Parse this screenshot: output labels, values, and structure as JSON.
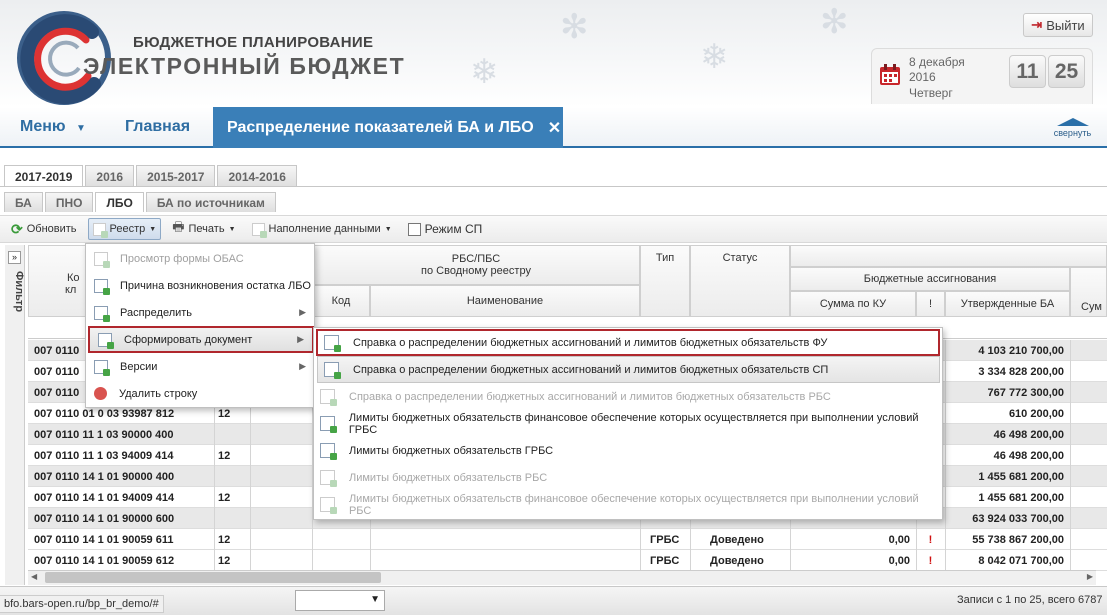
{
  "header": {
    "brand_line1": "БЮДЖЕТНОЕ ПЛАНИРОВАНИЕ",
    "brand_line2": "ЭЛЕКТРОННЫЙ БЮДЖЕТ",
    "logout_label": "Выйти",
    "date_line1": "8 декабря",
    "date_line2": "2016",
    "date_line3": "Четверг",
    "clock_hours": "11",
    "clock_minutes": "25"
  },
  "nav": {
    "menu_label": "Меню",
    "home_label": "Главная",
    "active_tab_label": "Распределение показателей БА и ЛБО",
    "collapse_label": "свернуть"
  },
  "period_tabs": [
    "2017-2019",
    "2016",
    "2015-2017",
    "2014-2016"
  ],
  "type_tabs": [
    "БА",
    "ПНО",
    "ЛБО",
    "БА по источникам"
  ],
  "toolbar": {
    "refresh": "Обновить",
    "registry": "Реестр",
    "print": "Печать",
    "fill_data": "Наполнение данными",
    "sp_mode": "Режим СП"
  },
  "filter_label": "Фильтр",
  "columns": {
    "code_class_part1": "Ко",
    "code_class_part2": "кл",
    "rbs": "РБС/ПБС\nпо Сводному реестру",
    "rbs_code": "Код",
    "rbs_name": "Наименование",
    "type": "Тип",
    "status": "Статус",
    "budget_alloc": "Бюджетные ассигнования",
    "sum_ku": "Сумма по КУ",
    "excl": "!",
    "approved_ba": "Утвержденные БА",
    "sum_cut": "Сум"
  },
  "rows": [
    {
      "code": "007 0110",
      "num": "",
      "type": "",
      "status": "",
      "sum": "",
      "flag": "",
      "approved": "4 103 210 700,00"
    },
    {
      "code": "007 0110",
      "num": "",
      "type": "",
      "status": "",
      "sum": "",
      "flag": "",
      "approved": "3 334 828 200,00"
    },
    {
      "code": "007 0110",
      "num": "",
      "type": "",
      "status": "",
      "sum": "",
      "flag": "",
      "approved": "767 772 300,00"
    },
    {
      "code": "007 0110 01 0 03 93987 812",
      "num": "12",
      "type": "",
      "status": "",
      "sum": "",
      "flag": "",
      "approved": "610 200,00"
    },
    {
      "code": "007 0110 11 1 03 90000 400",
      "num": "",
      "type": "",
      "status": "",
      "sum": "",
      "flag": "",
      "approved": "46 498 200,00"
    },
    {
      "code": "007 0110 11 1 03 94009 414",
      "num": "12",
      "type": "",
      "status": "",
      "sum": "",
      "flag": "",
      "approved": "46 498 200,00"
    },
    {
      "code": "007 0110 14 1 01 90000 400",
      "num": "",
      "type": "",
      "status": "",
      "sum": "",
      "flag": "",
      "approved": "1 455 681 200,00"
    },
    {
      "code": "007 0110 14 1 01 94009 414",
      "num": "12",
      "type": "",
      "status": "",
      "sum": "",
      "flag": "",
      "approved": "1 455 681 200,00"
    },
    {
      "code": "007 0110 14 1 01 90000 600",
      "num": "",
      "type": "",
      "status": "",
      "sum": "",
      "flag": "",
      "approved": "63 924 033 700,00"
    },
    {
      "code": "007 0110 14 1 01 90059 611",
      "num": "12",
      "type": "ГРБС",
      "status": "Доведено",
      "sum": "0,00",
      "flag": "!",
      "approved": "55 738 867 200,00"
    },
    {
      "code": "007 0110 14 1 01 90059 612",
      "num": "12",
      "type": "ГРБС",
      "status": "Доведено",
      "sum": "0,00",
      "flag": "!",
      "approved": "8 042 071 700,00"
    }
  ],
  "registry_menu": [
    {
      "label": "Просмотр формы ОБАС",
      "disabled": true
    },
    {
      "label": "Причина возникновения остатка ЛБО",
      "disabled": false
    },
    {
      "label": "Распределить",
      "disabled": false,
      "submenu": true
    },
    {
      "label": "Сформировать документ",
      "disabled": false,
      "submenu": true,
      "highlighted": true
    },
    {
      "label": "Версии",
      "disabled": false,
      "submenu": true
    },
    {
      "label": "Удалить строку",
      "disabled": false
    }
  ],
  "document_submenu": [
    {
      "label": "Справка о распределении бюджетных ассигнований и лимитов бюджетных обязательств ФУ",
      "disabled": false,
      "highlighted": true
    },
    {
      "label": "Справка о распределении бюджетных ассигнований и лимитов бюджетных обязательств СП",
      "disabled": false,
      "hover": true
    },
    {
      "label": "Справка о распределении бюджетных ассигнований и лимитов бюджетных обязательств РБС",
      "disabled": true
    },
    {
      "label": "Лимиты бюджетных обязательств финансовое обеспечение которых осуществляется при выполнении условий ГРБС",
      "disabled": false
    },
    {
      "label": "Лимиты бюджетных обязательств ГРБС",
      "disabled": false
    },
    {
      "label": "Лимиты бюджетных обязательств РБС",
      "disabled": true
    },
    {
      "label": "Лимиты бюджетных обязательств финансовое обеспечение которых осуществляется при выполнении условий РБС",
      "disabled": true
    }
  ],
  "statusbar": {
    "url": "bfo.bars-open.ru/bp_br_demo/#",
    "records": "Записи с 1 по 25, всего 6787"
  },
  "colors": {
    "accent_blue": "#3a7fb8",
    "highlight_red": "#b0272d",
    "flag_red": "#d01010"
  }
}
